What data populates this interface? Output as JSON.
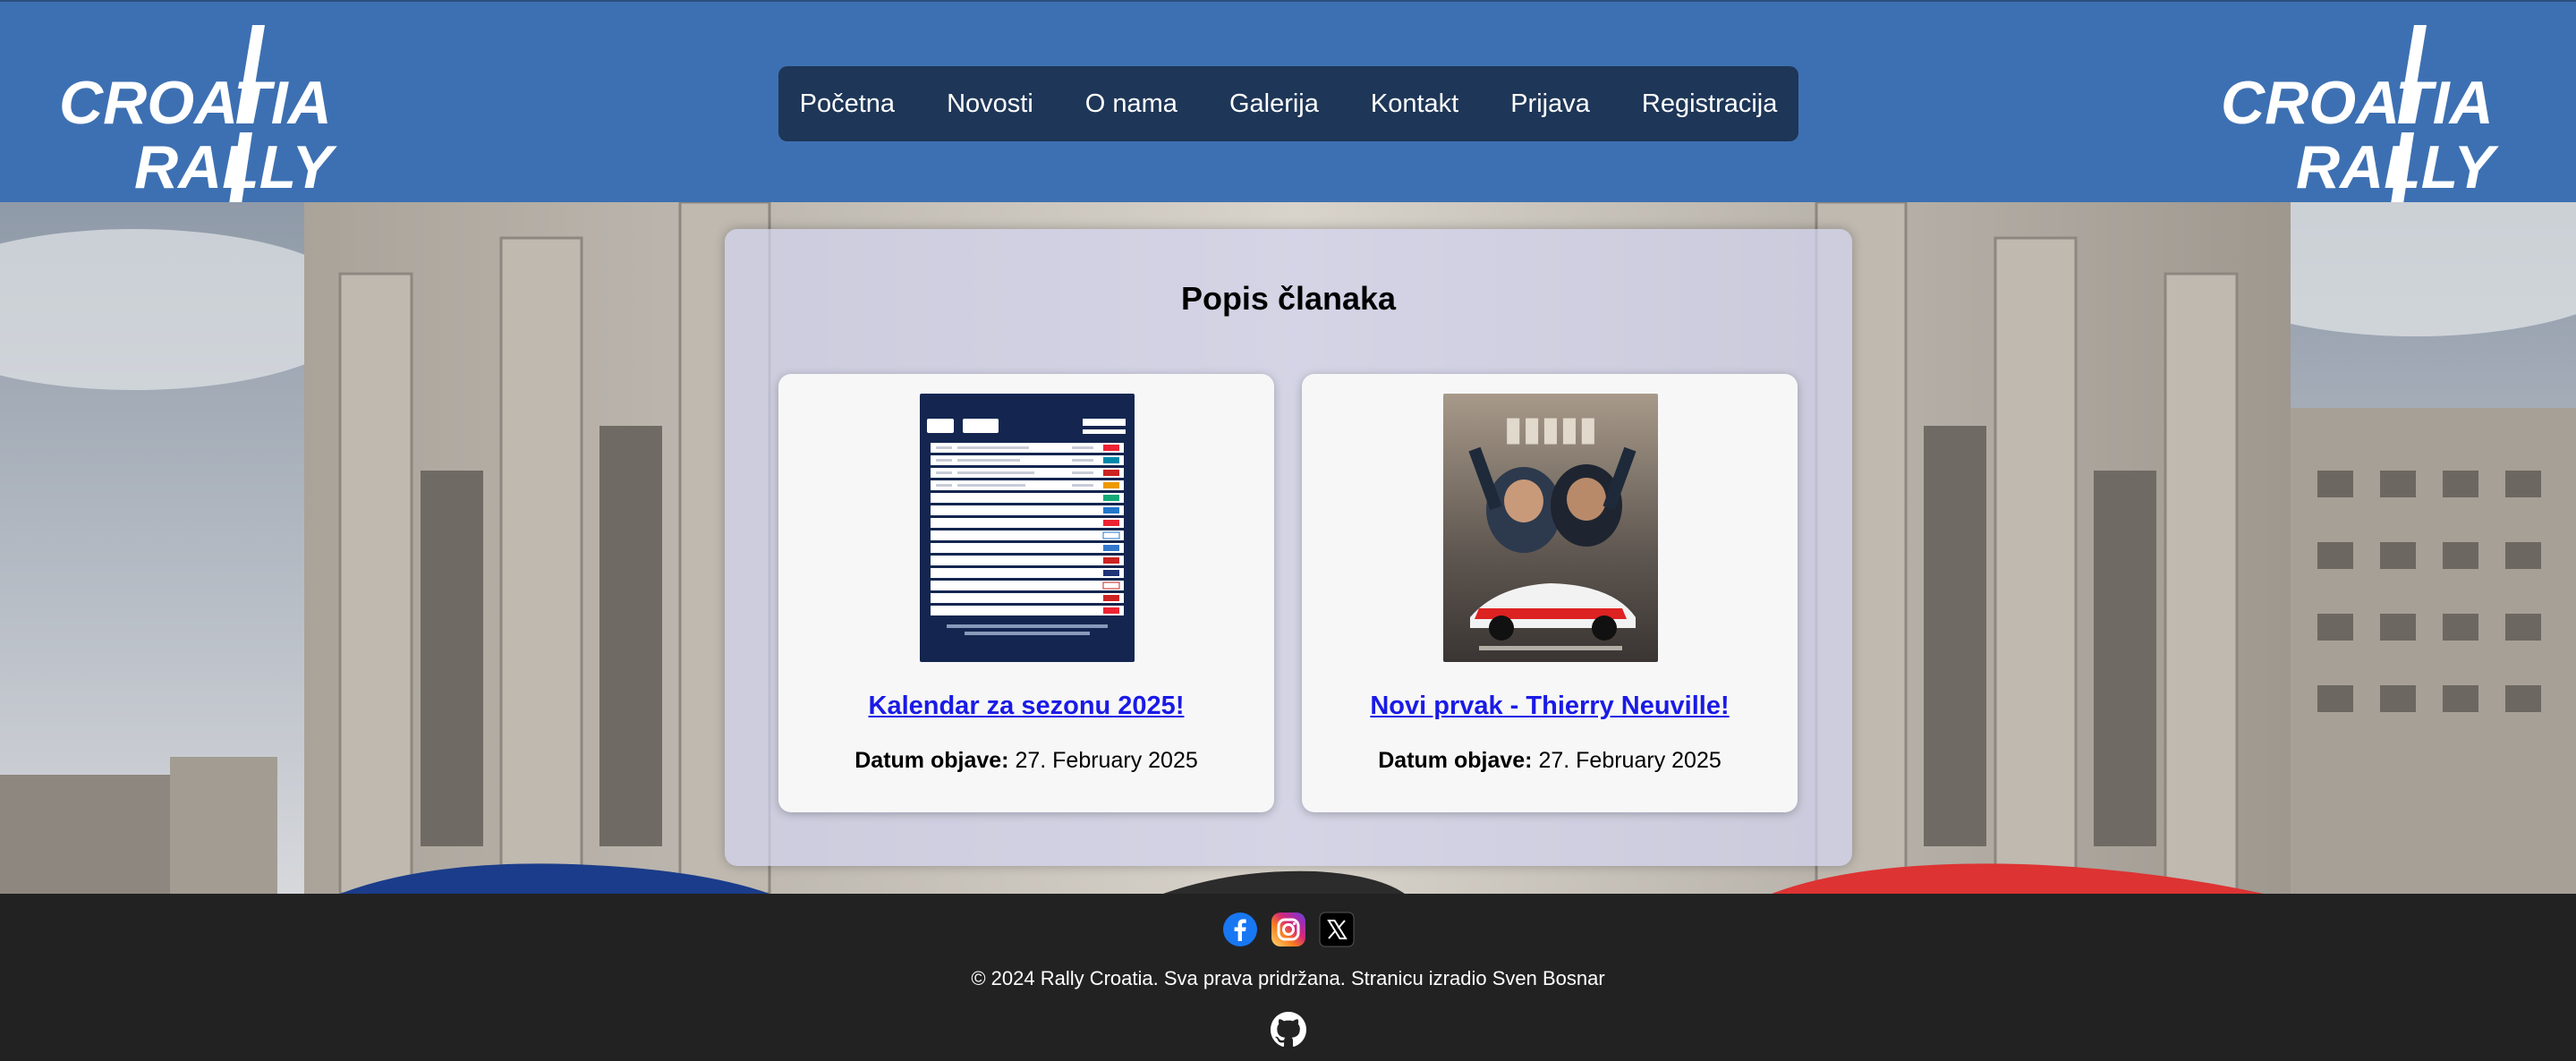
{
  "header": {
    "logo_line1": "CROATIA",
    "logo_line2": "RALLY",
    "nav": [
      "Početna",
      "Novosti",
      "O nama",
      "Galerija",
      "Kontakt",
      "Prijava",
      "Registracija"
    ]
  },
  "main": {
    "title": "Popis članaka",
    "articles": [
      {
        "title": "Kalendar za sezonu 2025!",
        "date_label": "Datum objave:",
        "date": "27. February 2025",
        "image": "wrc-calendar-2025-poster"
      },
      {
        "title": "Novi prvak - Thierry Neuville!",
        "date_label": "Datum objave:",
        "date": "27. February 2025",
        "image": "champions-poster"
      }
    ]
  },
  "footer": {
    "social": [
      "facebook-icon",
      "instagram-icon",
      "x-icon"
    ],
    "copyright": "© 2024 Rally Croatia. Sva prava pridržana. Stranicu izradio Sven Bosnar",
    "github": "github-icon"
  },
  "colors": {
    "header_bg": "#3d70b2",
    "nav_bg": "#1e3657",
    "footer_bg": "#222222",
    "link": "#1a1ae6"
  }
}
